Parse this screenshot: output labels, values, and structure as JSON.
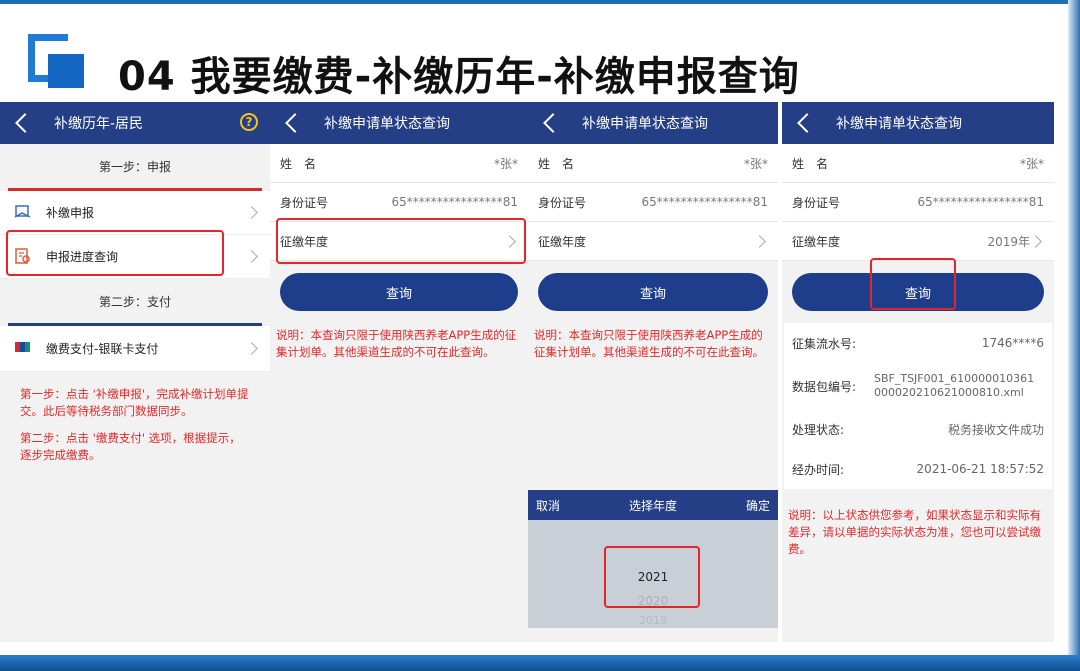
{
  "title": "04 我要缴费-补缴历年-补缴申报查询",
  "colors": {
    "header_bg": "#243f86",
    "button_bg": "#1e3d8a",
    "highlight": "#e3262a",
    "note_text": "#e02a2a"
  },
  "screen1": {
    "header": "补缴历年-居民",
    "help_icon": "?",
    "step1": "第一步：申报",
    "items": [
      "补缴申报",
      "申报进度查询"
    ],
    "step2": "第二步：支付",
    "pay_item": "缴费支付-银联卡支付",
    "note1": "第一步：点击 '补缴申报'，完成补缴计划单提交。此后等待税务部门数据同步。",
    "note2": "第二步：点击 '缴费支付' 选项，根据提示，逐步完成缴费。"
  },
  "screen2": {
    "header": "补缴申请单状态查询",
    "name_label": "姓　名",
    "name_val": "*张*",
    "id_label": "身份证号",
    "id_val": "65****************81",
    "year_label": "征缴年度",
    "year_val": "",
    "btn": "查询",
    "note": "说明：本查询只限于使用陕西养老APP生成的征集计划单。其他渠道生成的不可在此查询。"
  },
  "screen3": {
    "header": "补缴申请单状态查询",
    "name_label": "姓　名",
    "name_val": "*张*",
    "id_label": "身份证号",
    "id_val": "65****************81",
    "year_label": "征缴年度",
    "btn": "查询",
    "note": "说明：本查询只限于使用陕西养老APP生成的征集计划单。其他渠道生成的不可在此查询。",
    "picker": {
      "cancel": "取消",
      "title": "选择年度",
      "confirm": "确定",
      "selected": "2021",
      "next1": "2020",
      "next2": "2019",
      "next3": "2018"
    }
  },
  "screen4": {
    "header": "补缴申请单状态查询",
    "name_label": "姓　名",
    "name_val": "*张*",
    "id_label": "身份证号",
    "id_val": "65****************81",
    "year_label": "征缴年度",
    "year_val": "2019年",
    "btn": "查询",
    "serial_label": "征集流水号:",
    "serial_val": "1746****6",
    "pkg_label": "数据包编号:",
    "pkg_val1": "SBF_TSJF001_610000010361",
    "pkg_val2": "000020210621000810.xml",
    "status_label": "处理状态:",
    "status_val": "税务接收文件成功",
    "time_label": "经办时间:",
    "time_val": "2021-06-21 18:57:52",
    "note": "说明：以上状态供您参考，如果状态显示和实际有差异，请以单据的实际状态为准，您也可以尝试缴费。"
  }
}
